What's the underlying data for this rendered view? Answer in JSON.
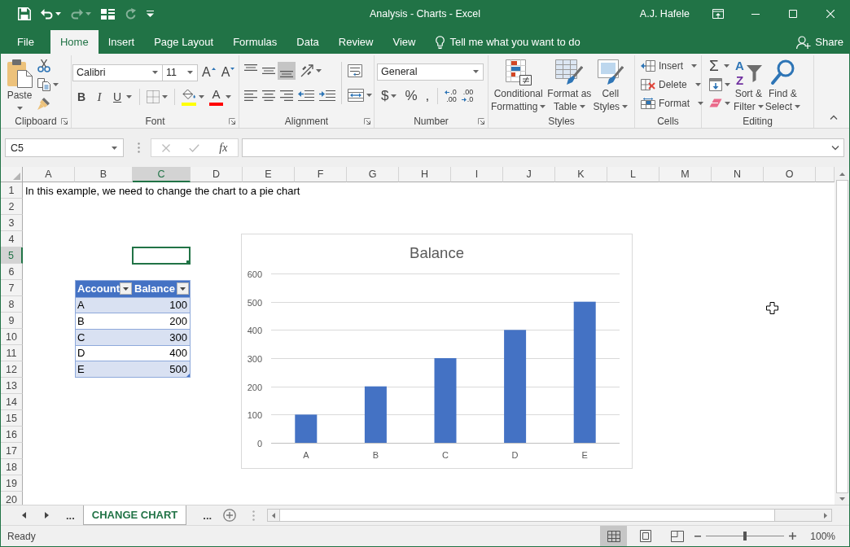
{
  "window": {
    "title": "Analysis - Charts - Excel",
    "user": "A.J. Hafele"
  },
  "quick_access": [
    {
      "kind": "save",
      "disabled": false
    },
    {
      "kind": "undo",
      "disabled": false
    },
    {
      "kind": "redo",
      "disabled": true
    },
    {
      "kind": "form",
      "disabled": false
    },
    {
      "kind": "repeat",
      "disabled": true
    },
    {
      "kind": "customize",
      "disabled": false
    }
  ],
  "tabs": [
    {
      "label": "File",
      "selected": false
    },
    {
      "label": "Home",
      "selected": true
    },
    {
      "label": "Insert",
      "selected": false
    },
    {
      "label": "Page Layout",
      "selected": false
    },
    {
      "label": "Formulas",
      "selected": false
    },
    {
      "label": "Data",
      "selected": false
    },
    {
      "label": "Review",
      "selected": false
    },
    {
      "label": "View",
      "selected": false
    }
  ],
  "tell_me": {
    "placeholder": "Tell me what you want to do"
  },
  "share": {
    "label": "Share"
  },
  "ribbon": {
    "groups": [
      {
        "kind": "clipboard",
        "label": "Clipboard",
        "paste": "Paste"
      },
      {
        "kind": "font",
        "label": "Font",
        "font_name": "Calibri",
        "font_size": "11",
        "grow": "A",
        "shrink": "A",
        "styles": [
          {
            "kind": "bold",
            "label": "B",
            "selected": false
          },
          {
            "kind": "italic",
            "label": "I",
            "selected": false
          },
          {
            "kind": "underline",
            "label": "U",
            "selected": false
          }
        ],
        "fill_color": {
          "color": "#ffff00"
        },
        "font_color": {
          "label": "A",
          "color": "#ff0000"
        }
      },
      {
        "kind": "alignment",
        "label": "Alignment",
        "vertical": [
          {
            "kind": "top",
            "selected": false
          },
          {
            "kind": "middle",
            "selected": false
          },
          {
            "kind": "bottom",
            "selected": true
          }
        ],
        "horizontal": [
          {
            "kind": "left",
            "selected": false
          },
          {
            "kind": "center",
            "selected": false
          },
          {
            "kind": "right",
            "selected": false
          }
        ]
      },
      {
        "kind": "number",
        "label": "Number",
        "format": "General",
        "symbols": [
          {
            "kind": "currency",
            "label": "$"
          },
          {
            "kind": "percent",
            "label": "%"
          },
          {
            "kind": "comma",
            "label": ","
          }
        ],
        "decimals": [
          {
            "kind": "increase",
            "lines": [
              ".0",
              ".00"
            ]
          },
          {
            "kind": "decrease",
            "lines": [
              ".00",
              ".0"
            ]
          }
        ]
      },
      {
        "kind": "styles",
        "label": "Styles",
        "buttons": [
          {
            "kind": "conditional",
            "lines": [
              "Conditional",
              "Formatting"
            ]
          },
          {
            "kind": "table",
            "lines": [
              "Format as",
              "Table"
            ]
          },
          {
            "kind": "cell",
            "lines": [
              "Cell",
              "Styles"
            ]
          }
        ]
      },
      {
        "kind": "cells",
        "label": "Cells",
        "buttons": [
          {
            "kind": "insert",
            "label": "Insert"
          },
          {
            "kind": "delete",
            "label": "Delete"
          },
          {
            "kind": "format",
            "label": "Format"
          }
        ]
      },
      {
        "kind": "editing",
        "label": "Editing",
        "small": [
          {
            "kind": "sum",
            "label": "Σ"
          },
          {
            "kind": "fill"
          },
          {
            "kind": "clear"
          }
        ],
        "buttons": [
          {
            "kind": "sort",
            "lines": [
              "Sort &",
              "Filter"
            ],
            "letters": [
              "A",
              "Z"
            ]
          },
          {
            "kind": "find",
            "lines": [
              "Find &",
              "Select"
            ]
          }
        ]
      }
    ]
  },
  "formula_bar": {
    "name_box": "C5",
    "commands": [
      {
        "kind": "cancel",
        "disabled": true
      },
      {
        "kind": "enter",
        "disabled": true
      }
    ],
    "insert_function": "fx"
  },
  "sheet": {
    "columns": [
      {
        "label": "A",
        "selected": false
      },
      {
        "label": "B",
        "selected": false
      },
      {
        "label": "C",
        "selected": true
      },
      {
        "label": "D",
        "selected": false
      },
      {
        "label": "E",
        "selected": false
      },
      {
        "label": "F",
        "selected": false
      },
      {
        "label": "G",
        "selected": false
      },
      {
        "label": "H",
        "selected": false
      },
      {
        "label": "I",
        "selected": false
      },
      {
        "label": "J",
        "selected": false
      },
      {
        "label": "K",
        "selected": false
      },
      {
        "label": "L",
        "selected": false
      },
      {
        "label": "M",
        "selected": false
      },
      {
        "label": "N",
        "selected": false
      },
      {
        "label": "O",
        "selected": false
      }
    ],
    "rows": [
      {
        "label": "1",
        "selected": false
      },
      {
        "label": "2",
        "selected": false
      },
      {
        "label": "3",
        "selected": false
      },
      {
        "label": "4",
        "selected": false
      },
      {
        "label": "5",
        "selected": true
      },
      {
        "label": "6",
        "selected": false
      },
      {
        "label": "7",
        "selected": false
      },
      {
        "label": "8",
        "selected": false
      },
      {
        "label": "9",
        "selected": false
      },
      {
        "label": "10",
        "selected": false
      },
      {
        "label": "11",
        "selected": false
      },
      {
        "label": "12",
        "selected": false
      },
      {
        "label": "13",
        "selected": false
      },
      {
        "label": "14",
        "selected": false
      },
      {
        "label": "15",
        "selected": false
      },
      {
        "label": "16",
        "selected": false
      },
      {
        "label": "17",
        "selected": false
      },
      {
        "label": "18",
        "selected": false
      },
      {
        "label": "19",
        "selected": false
      },
      {
        "label": "20",
        "selected": false
      }
    ],
    "note": "In this example, we need to change the chart to a pie chart",
    "table": {
      "columns": [
        {
          "label": "Account",
          "filter": true
        },
        {
          "label": "Balance",
          "filter": true
        }
      ],
      "rows": [
        [
          "A",
          "100"
        ],
        [
          "B",
          "200"
        ],
        [
          "C",
          "300"
        ],
        [
          "D",
          "400"
        ],
        [
          "E",
          "500"
        ]
      ]
    },
    "chart": {
      "chart_data": {
        "type": "bar",
        "title": "Balance",
        "categories": [
          "A",
          "B",
          "C",
          "D",
          "E"
        ],
        "series": [
          {
            "color": "#4472c4",
            "values": [
              100,
              200,
              300,
              400,
              500
            ]
          }
        ],
        "ylim": [
          0,
          600
        ],
        "yticks": [
          0,
          100,
          200,
          300,
          400,
          500,
          600
        ],
        "grid": true
      }
    }
  },
  "sheet_tabs": [
    {
      "kind": "more",
      "label": "...",
      "selected": false
    },
    {
      "kind": "sheet",
      "label": "CHANGE CHART",
      "selected": true
    },
    {
      "kind": "more",
      "label": "...",
      "selected": false
    }
  ],
  "status_bar": {
    "status": "Ready",
    "views": [
      {
        "kind": "normal",
        "selected": true
      },
      {
        "kind": "page_layout",
        "selected": false
      },
      {
        "kind": "page_break",
        "selected": false
      }
    ],
    "zoom": {
      "level": 0.5,
      "reading": "100%"
    }
  }
}
